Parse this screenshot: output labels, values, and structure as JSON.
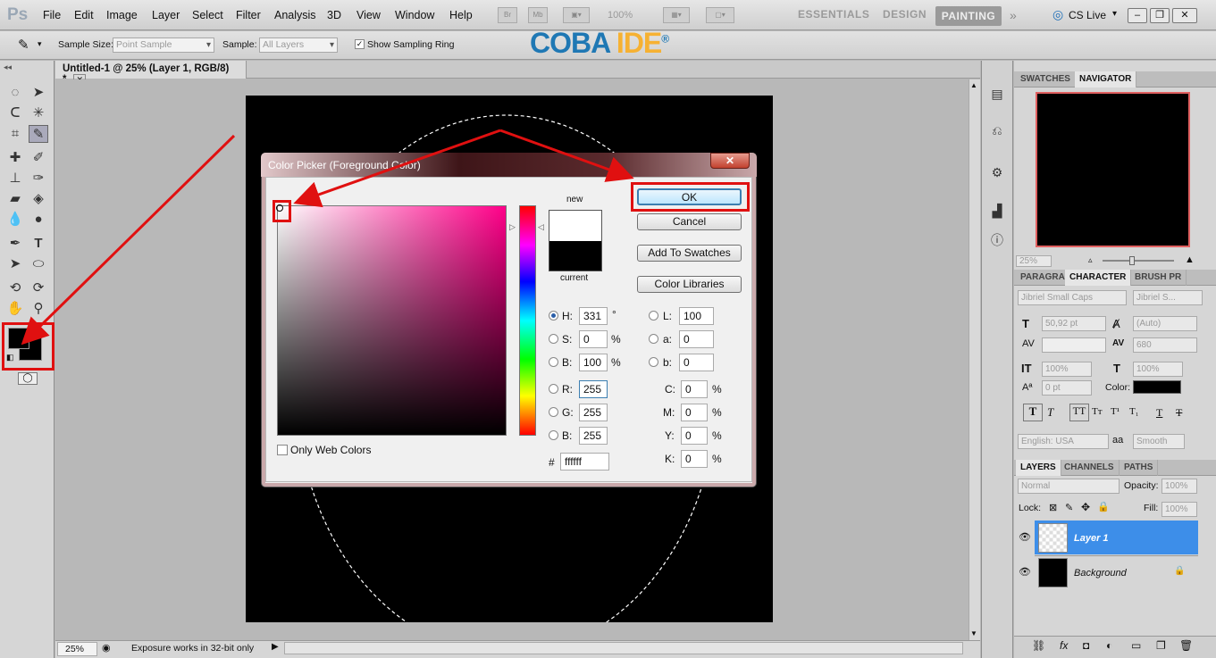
{
  "menubar": {
    "app_icon": "Ps",
    "items": [
      "File",
      "Edit",
      "Image",
      "Layer",
      "Select",
      "Filter",
      "Analysis",
      "3D",
      "View",
      "Window",
      "Help"
    ],
    "bridge_icon": "Br",
    "minibridge_icon": "Mb",
    "zoom": "100%",
    "workspaces": [
      "ESSENTIALS",
      "DESIGN",
      "PAINTING"
    ],
    "cslive": "CS Live"
  },
  "options": {
    "sample_size_label": "Sample Size:",
    "sample_size_value": "Point Sample",
    "sample_label": "Sample:",
    "sample_value": "All Layers",
    "ring_label": "Show Sampling Ring",
    "ring_checked": true
  },
  "watermark": {
    "part1": "COBA",
    "part2": "IDE",
    "reg": "®"
  },
  "document": {
    "tab_title": "Untitled-1 @ 25% (Layer 1, RGB/8) *",
    "zoom": "25%",
    "status": "Exposure works in 32-bit only"
  },
  "color_picker": {
    "title": "Color Picker (Foreground Color)",
    "new_label": "new",
    "current_label": "current",
    "ok": "OK",
    "cancel": "Cancel",
    "add_swatches": "Add To Swatches",
    "color_libraries": "Color Libraries",
    "only_web": "Only Web Colors",
    "hsb": {
      "H": "331",
      "S": "0",
      "B": "100",
      "h_unit": "°",
      "s_unit": "%",
      "b_unit": "%"
    },
    "rgb": {
      "R": "255",
      "G": "255",
      "B": "255"
    },
    "lab": {
      "L": "100",
      "a": "0",
      "b": "0"
    },
    "cmyk": {
      "C": "0",
      "M": "0",
      "Y": "0",
      "K": "0",
      "unit": "%"
    },
    "hex_label": "#",
    "hex": "ffffff",
    "new_color": "#ffffff",
    "current_color": "#000000"
  },
  "panels": {
    "top_tabs": [
      "SWATCHES",
      "NAVIGATOR"
    ],
    "nav_zoom": "25%",
    "char_tabs": [
      "PARAGRA",
      "CHARACTER",
      "BRUSH PR"
    ],
    "font_family": "Jibriel Small Caps",
    "font_style": "Jibriel S...",
    "font_size": "50,92 pt",
    "leading": "(Auto)",
    "tracking": "680",
    "vscale": "100%",
    "hscale": "100%",
    "baseline": "0 pt",
    "color_label": "Color:",
    "language": "English: USA",
    "aa_label": "a",
    "antialias": "Smooth",
    "layer_tabs": [
      "LAYERS",
      "CHANNELS",
      "PATHS"
    ],
    "blend": "Normal",
    "opacity_label": "Opacity:",
    "opacity": "100%",
    "lock_label": "Lock:",
    "fill_label": "Fill:",
    "fill": "100%",
    "layers": [
      {
        "name": "Layer 1"
      },
      {
        "name": "Background"
      }
    ]
  }
}
